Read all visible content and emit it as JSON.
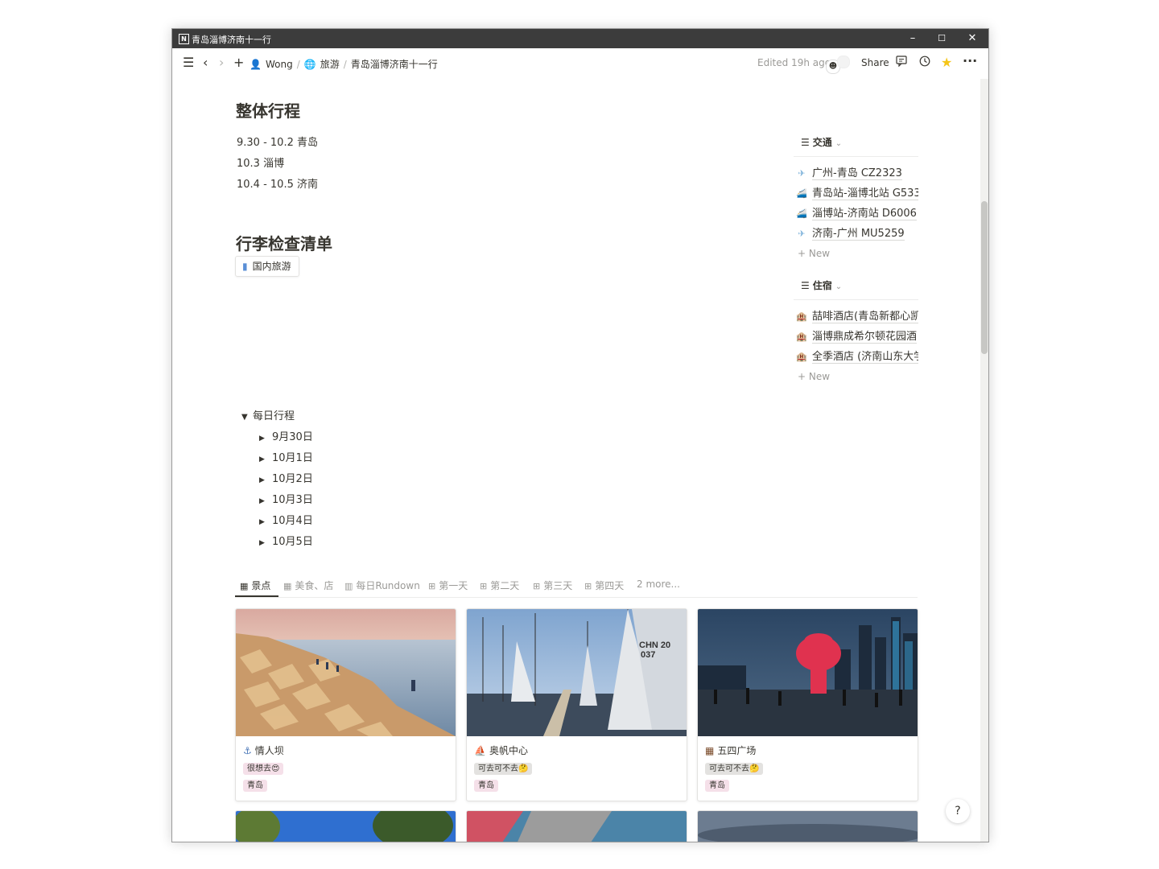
{
  "window": {
    "title": "青岛淄博济南十一行",
    "controls": {
      "minimize": "–",
      "maximize": "☐",
      "close": "✕"
    }
  },
  "topbar": {
    "breadcrumb": [
      "Wong",
      "旅游",
      "青岛淄博济南十一行"
    ],
    "edited": "Edited 19h ago",
    "share": "Share",
    "icons": [
      "menu-icon",
      "back-icon",
      "forward-icon",
      "plus-icon",
      "comment-icon",
      "history-icon",
      "star-icon",
      "more-icon"
    ]
  },
  "main": {
    "heading1": "整体行程",
    "itinerary": [
      "9.30 - 10.2 青岛",
      "10.3 淄博",
      "10.4 - 10.5 济南"
    ],
    "heading2": "行李检查清单",
    "checklist_link": "国内旅游",
    "daily": {
      "title": "每日行程",
      "items": [
        "9月30日",
        "10月1日",
        "10月2日",
        "10月3日",
        "10月4日",
        "10月5日"
      ]
    }
  },
  "sidebar": {
    "transport": {
      "title": "交通",
      "items": [
        "广州-青岛 CZ2323",
        "青岛站-淄博北站 G533",
        "淄博站-济南站 D6006",
        "济南-广州 MU5259"
      ],
      "new": "New"
    },
    "lodging": {
      "title": "住宿",
      "items": [
        "喆啡酒店(青岛新都心凯",
        "淄博鼎成希尔顿花园酒",
        "全季酒店 (济南山东大学"
      ],
      "new": "New"
    }
  },
  "tabs": {
    "items": [
      "景点",
      "美食、店",
      "每日Rundown",
      "第一天",
      "第二天",
      "第三天",
      "第四天"
    ],
    "more": "2 more..."
  },
  "cards": [
    {
      "name": "情人坝",
      "tag1": "很想去😍",
      "tag2": "青岛"
    },
    {
      "name": "奥帆中心",
      "tag1": "可去可不去🤔",
      "tag2": "青岛"
    },
    {
      "name": "五四广场",
      "tag1": "可去可不去🤔",
      "tag2": "青岛"
    }
  ],
  "photo_text": {
    "sail_number": "CHN 20",
    "sail_number2": "037"
  },
  "help": "?",
  "colors": {
    "titlebar": "#3c3c3c",
    "tag_pink": "#f5e0e9",
    "tag_gray": "#e3e2e0",
    "star": "#f5c518"
  }
}
